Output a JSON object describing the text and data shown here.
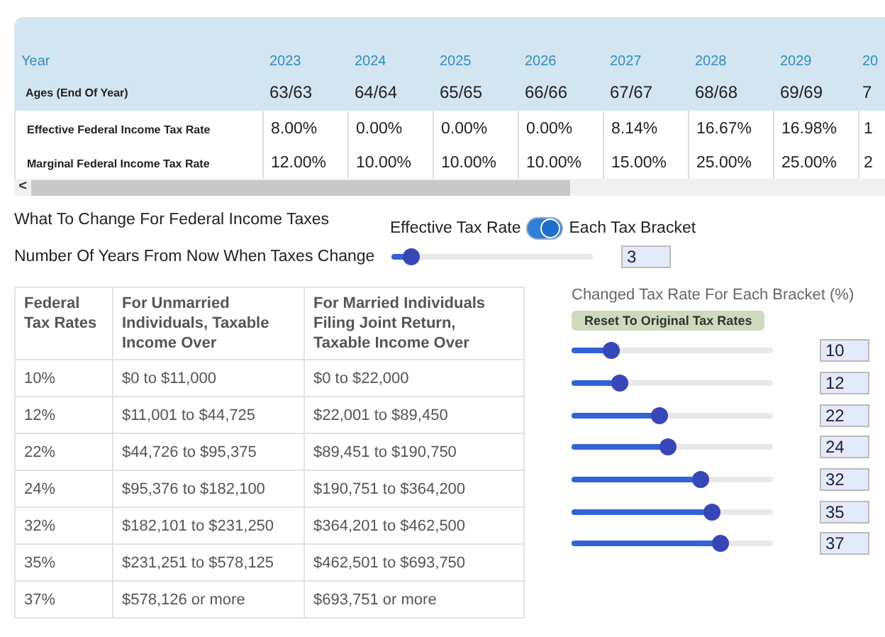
{
  "projection_table": {
    "year_label": "Year",
    "ages_label": "Ages (End Of Year)",
    "years": [
      "2023",
      "2024",
      "2025",
      "2026",
      "2027",
      "2028",
      "2029",
      "20"
    ],
    "ages": [
      "63/63",
      "64/64",
      "65/65",
      "66/66",
      "67/67",
      "68/68",
      "69/69",
      "7"
    ],
    "rows": [
      {
        "label": "Effective Federal Income Tax Rate",
        "values": [
          "8.00%",
          "0.00%",
          "0.00%",
          "0.00%",
          "8.14%",
          "16.67%",
          "16.98%",
          "1"
        ]
      },
      {
        "label": "Marginal Federal Income Tax Rate",
        "values": [
          "12.00%",
          "10.00%",
          "10.00%",
          "10.00%",
          "15.00%",
          "25.00%",
          "25.00%",
          "2"
        ]
      }
    ],
    "scroll_left": "<"
  },
  "change_what": {
    "label": "What To Change For Federal Income Taxes",
    "left_option": "Effective Tax Rate",
    "right_option": "Each Tax Bracket",
    "on": true
  },
  "years_change": {
    "label": "Number Of Years From Now When Taxes Change",
    "level": 0.1,
    "value": "3"
  },
  "bracket_table": {
    "columns": [
      "Federal Tax Rates",
      "For Unmarried Individuals, Taxable Income Over",
      "For Married Individuals Filing Joint Return, Taxable Income Over"
    ],
    "rows": [
      [
        "10%",
        "$0 to $11,000",
        "$0 to $22,000"
      ],
      [
        "12%",
        "$11,001 to $44,725",
        "$22,001 to $89,450"
      ],
      [
        "22%",
        "$44,726 to $95,375",
        "$89,451 to $190,750"
      ],
      [
        "24%",
        "$95,376 to $182,100",
        "$190,751 to $364,200"
      ],
      [
        "32%",
        "$182,101 to $231,250",
        "$364,201 to $462,500"
      ],
      [
        "35%",
        "$231,251 to $578,125",
        "$462,501 to $693,750"
      ],
      [
        "37%",
        "$578,126 or more",
        "$693,751 or more"
      ]
    ]
  },
  "bracket_changes": {
    "title": "Changed Tax Rate For Each Bracket (%)",
    "reset_button": "Reset To Original Tax Rates",
    "sliders": [
      {
        "level": 0.2,
        "value": "10"
      },
      {
        "level": 0.24,
        "value": "12"
      },
      {
        "level": 0.44,
        "value": "22"
      },
      {
        "level": 0.48,
        "value": "24"
      },
      {
        "level": 0.64,
        "value": "32"
      },
      {
        "level": 0.7,
        "value": "35"
      },
      {
        "level": 0.74,
        "value": "37"
      }
    ]
  }
}
